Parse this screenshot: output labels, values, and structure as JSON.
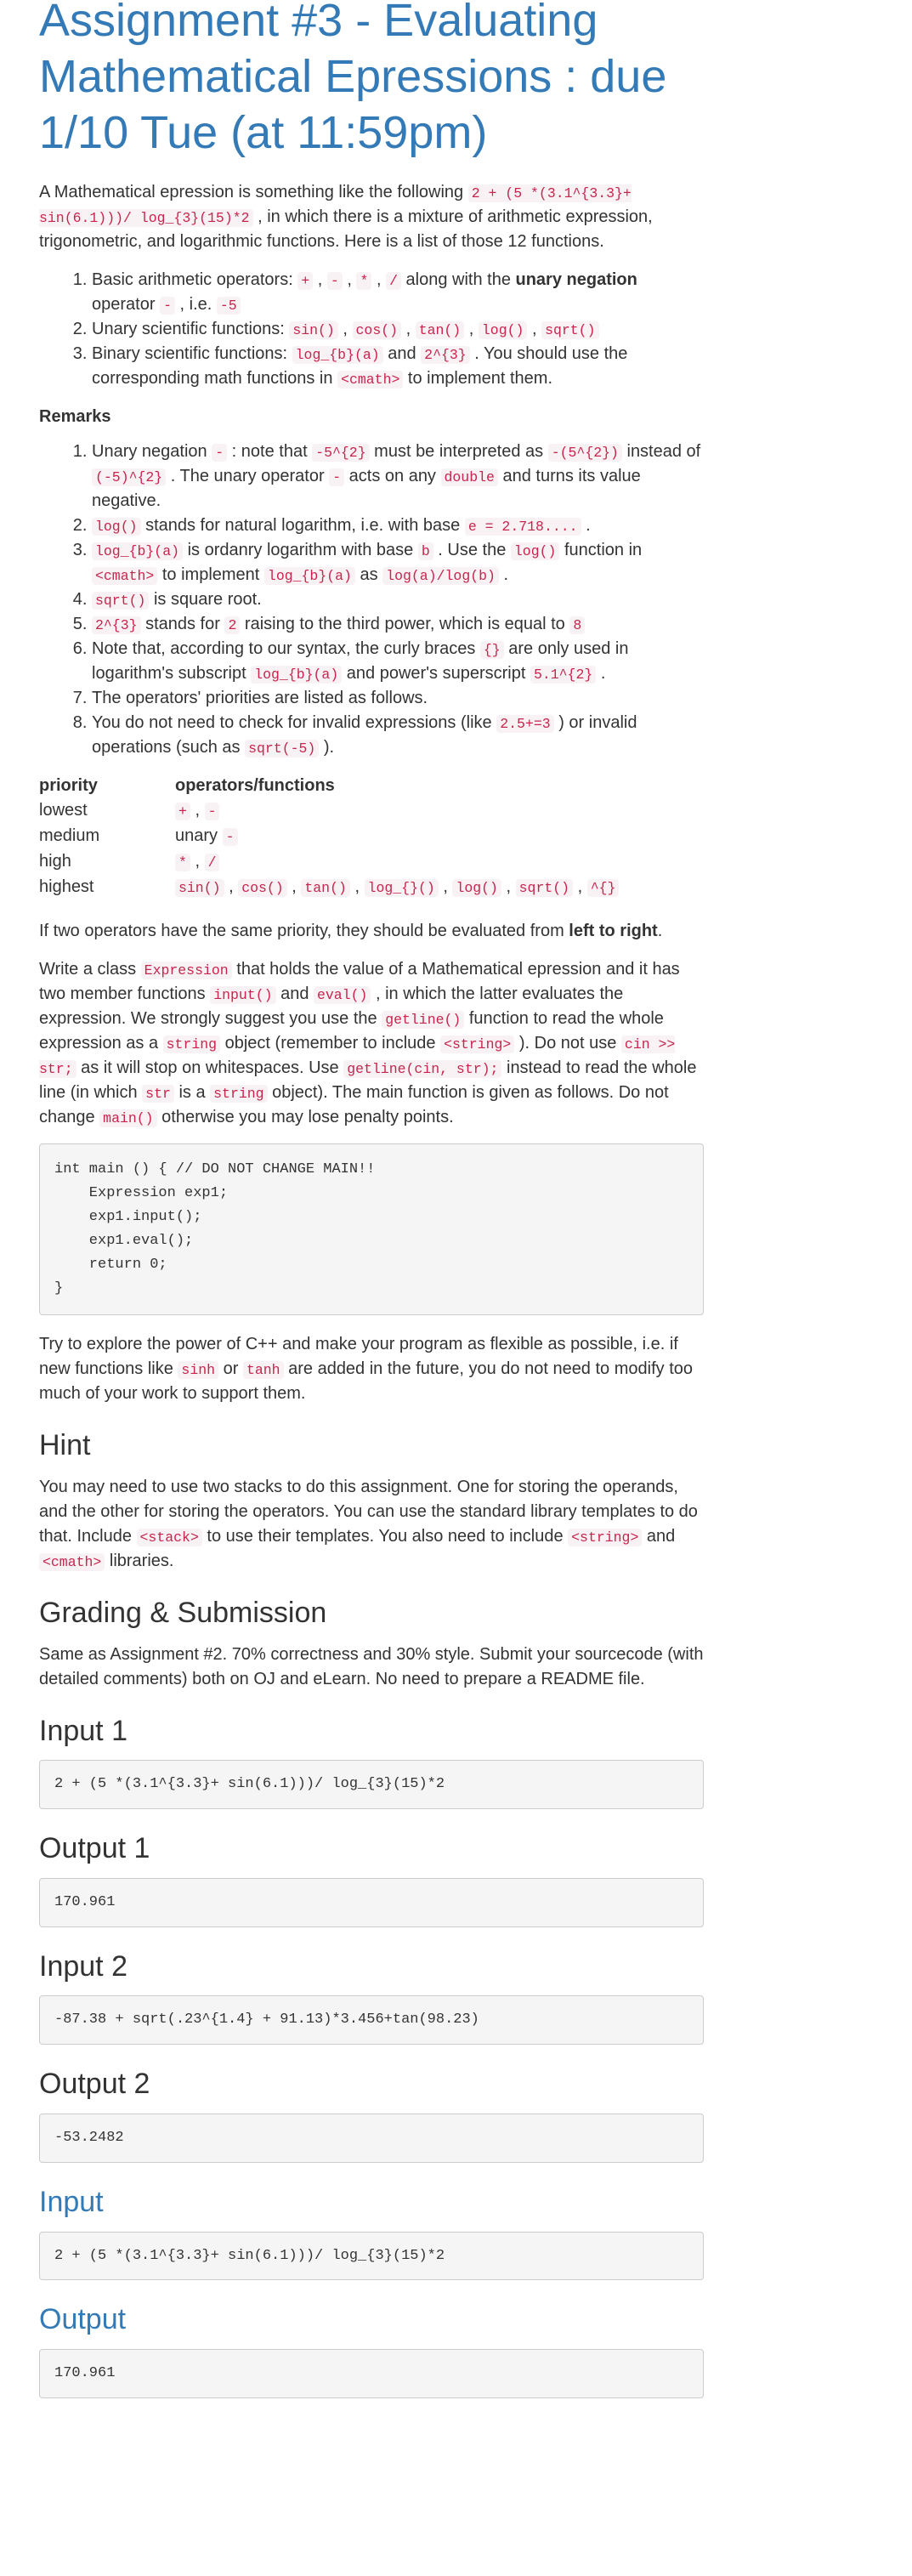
{
  "title": "Assignment #3 - Evaluating Mathematical Epressions : due 1/10 Tue (at 11:59pm)",
  "intro": {
    "t1": "A Mathematical epression is something like the following ",
    "c1": "2 + (5 *(3.1^{3.3}+ sin(6.1)))/ log_{3}(15)*2",
    "t2": " , in which there is a mixture of arithmetic expression, trigonometric, and logarithmic functions. Here is a list of those 12 functions."
  },
  "functions": {
    "item1": {
      "t1": "Basic arithmetic operators: ",
      "c_plus": "+",
      "sep1": " , ",
      "c_minus": "-",
      "sep2": " , ",
      "c_mul": "*",
      "sep3": " , ",
      "c_div": "/",
      "t2": " along with the ",
      "b1": "unary negation",
      "t3": " operator ",
      "c_neg": "-",
      "t4": " , i.e. ",
      "c_neg5": "-5"
    },
    "item2": {
      "t1": "Unary scientific functions: ",
      "c1": "sin()",
      "s1": " , ",
      "c2": "cos()",
      "s2": " , ",
      "c3": "tan()",
      "s3": " , ",
      "c4": "log()",
      "s4": " , ",
      "c5": "sqrt()"
    },
    "item3": {
      "t1": "Binary scientific functions: ",
      "c1": "log_{b}(a)",
      "t2": " and ",
      "c2": "2^{3}",
      "t3": " . You should use the corresponding math functions in ",
      "c3": "<cmath>",
      "t4": " to implement them."
    }
  },
  "remarks_heading": "Remarks",
  "remarks": {
    "r1": {
      "t1": "Unary negation ",
      "c1": "-",
      "t2": " : note that ",
      "c2": "-5^{2}",
      "t3": " must be interpreted as ",
      "c3": "-(5^{2})",
      "t4": " instead of ",
      "c4": "(-5)^{2}",
      "t5": " . The unary operator ",
      "c5": "-",
      "t6": " acts on any ",
      "c6": "double",
      "t7": " and turns its value negative."
    },
    "r2": {
      "c1": "log()",
      "t1": " stands for natural logarithm, i.e. with base ",
      "c2": "e = 2.718....",
      "t2": " ."
    },
    "r3": {
      "c1": "log_{b}(a)",
      "t1": " is ordanry logarithm with base ",
      "c2": "b",
      "t2": " . Use the ",
      "c3": "log()",
      "t3": " function in ",
      "c4": "<cmath>",
      "t4": " to implement ",
      "c5": "log_{b}(a)",
      "t5": " as ",
      "c6": "log(a)/log(b)",
      "t6": " ."
    },
    "r4": {
      "c1": "sqrt()",
      "t1": " is square root."
    },
    "r5": {
      "c1": "2^{3}",
      "t1": " stands for ",
      "c2": "2",
      "t2": " raising to the third power, which is equal to ",
      "c3": "8"
    },
    "r6": {
      "t1": "Note that, according to our syntax, the curly braces ",
      "c1": "{}",
      "t2": " are only used in logarithm's subscript ",
      "c2": "log_{b}(a)",
      "t3": " and power's superscript ",
      "c3": "5.1^{2}",
      "t4": " ."
    },
    "r7": {
      "t1": "The operators' priorities are listed as follows."
    },
    "r8": {
      "t1": "You do not need to check for invalid expressions (like ",
      "c1": "2.5+=3",
      "t2": " ) or invalid operations (such as ",
      "c2": "sqrt(-5)",
      "t3": " )."
    }
  },
  "priority_table": {
    "h1": "priority",
    "h2": "operators/functions",
    "lowest": {
      "label": "lowest",
      "c1": "+",
      "s1": " , ",
      "c2": "-"
    },
    "medium": {
      "label": "medium",
      "t1": "unary ",
      "c1": "-"
    },
    "high": {
      "label": "high",
      "c1": "*",
      "s1": " , ",
      "c2": "/"
    },
    "highest": {
      "label": "highest",
      "c1": "sin()",
      "s1": " , ",
      "c2": "cos()",
      "s2": " , ",
      "c3": "tan()",
      "s3": " , ",
      "c4": "log_{}()",
      "s4": " , ",
      "c5": "log()",
      "s5": " , ",
      "c6": "sqrt()",
      "s6": " , ",
      "c7": "^{}"
    }
  },
  "same_priority": {
    "t1": "If two operators have the same priority, they should be evaluated from ",
    "b1": "left to right",
    "t2": "."
  },
  "class_para": {
    "t1": "Write a class ",
    "c1": "Expression",
    "t2": " that holds the value of a Mathematical epression and it has two member functions ",
    "c2": "input()",
    "t3": " and ",
    "c3": "eval()",
    "t4": " , in which the latter evaluates the expression. We strongly suggest you use the ",
    "c4": "getline()",
    "t5": " function to read the whole expression as a ",
    "c5": "string",
    "t6": " object (remember to include ",
    "c6": "<string>",
    "t7": " ). Do not use ",
    "c7": "cin >> str;",
    "t8": " as it will stop on whitespaces. Use ",
    "c8": "getline(cin, str);",
    "t9": " instead to read the whole line (in which ",
    "c9": "str",
    "t10": " is a ",
    "c10": "string",
    "t11": " object). The main function is given as follows. Do not change ",
    "c11": "main()",
    "t12": " otherwise you may lose penalty points."
  },
  "main_code": "int main () { // DO NOT CHANGE MAIN!!\n    Expression exp1;\n    exp1.input();\n    exp1.eval();\n    return 0;\n}",
  "explore_para": {
    "t1": "Try to explore the power of C++ and make your program as flexible as possible, i.e. if new functions like ",
    "c1": "sinh",
    "t2": " or ",
    "c2": "tanh",
    "t3": " are added in the future, you do not need to modify too much of your work to support them."
  },
  "hint": {
    "heading": "Hint",
    "t1": "You may need to use two stacks to do this assignment. One for storing the operands, and the other for storing the operators. You can use the standard library templates to do that. Include ",
    "c1": "<stack>",
    "t2": " to use their templates. You also need to include ",
    "c2": "<string>",
    "t3": " and ",
    "c3": "<cmath>",
    "t4": " libraries."
  },
  "grading": {
    "heading": "Grading & Submission",
    "text": "Same as Assignment #2. 70% correctness and 30% style. Submit your sourcecode (with detailed comments) both on OJ and eLearn. No need to prepare a README file."
  },
  "samples": {
    "input1_heading": "Input 1",
    "input1": "2 + (5 *(3.1^{3.3}+ sin(6.1)))/ log_{3}(15)*2",
    "output1_heading": "Output 1",
    "output1": "170.961",
    "input2_heading": "Input 2",
    "input2": "-87.38 + sqrt(.23^{1.4} + 91.13)*3.456+tan(98.23)",
    "output2_heading": "Output 2",
    "output2": "-53.2482",
    "input_heading": "Input",
    "input": "2 + (5 *(3.1^{3.3}+ sin(6.1)))/ log_{3}(15)*2",
    "output_heading": "Output",
    "output": "170.961"
  }
}
